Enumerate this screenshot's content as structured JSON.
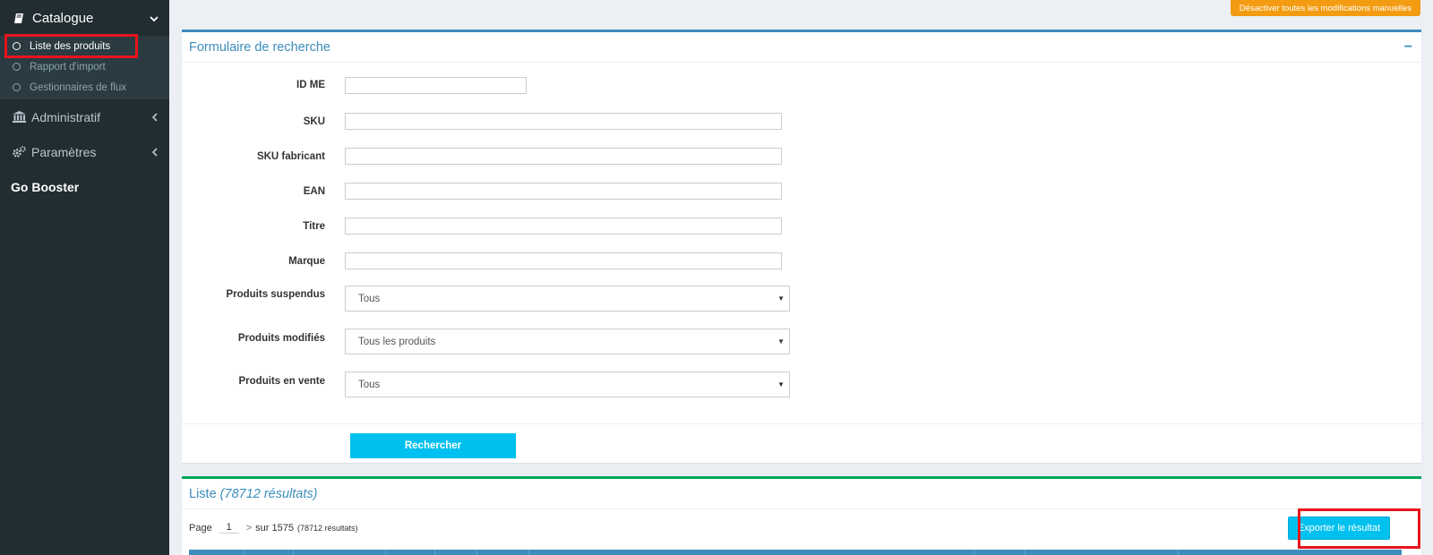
{
  "sidebar": {
    "catalogue": "Catalogue",
    "catalogue_items": [
      "Liste des produits",
      "Rapport d'import",
      "Gestionnaires de flux"
    ],
    "administratif": "Administratif",
    "parametres": "Paramètres",
    "brand": "Go Booster"
  },
  "top_button": "Désactiver toutes les modifications manuelles",
  "search_form": {
    "title": "Formulaire de recherche",
    "collapse": "−",
    "fields": {
      "id_me": "ID ME",
      "sku": "SKU",
      "sku_fab": "SKU fabricant",
      "ean": "EAN",
      "titre": "Titre",
      "marque": "Marque",
      "suspendus": "Produits suspendus",
      "modifies": "Produits modifiés",
      "en_vente": "Produits en vente"
    },
    "select_values": {
      "suspendus": "Tous",
      "modifies": "Tous les produits",
      "en_vente": "Tous"
    },
    "search_button": "Rechercher"
  },
  "list": {
    "title": "Liste",
    "count_label": "(78712 résultats)",
    "page_label": "Page",
    "page_num": "1",
    "next_icon": ">",
    "of_label": "sur 1575",
    "results_small": "(78712 résultats)",
    "export_button": "Exporter le résultat"
  },
  "colors": {
    "sidebar_bg": "#222d32",
    "primary": "#3c8dbc",
    "info": "#00c0ef",
    "warning": "#f39c12",
    "success": "#00a65a",
    "highlight": "#e8141c"
  }
}
